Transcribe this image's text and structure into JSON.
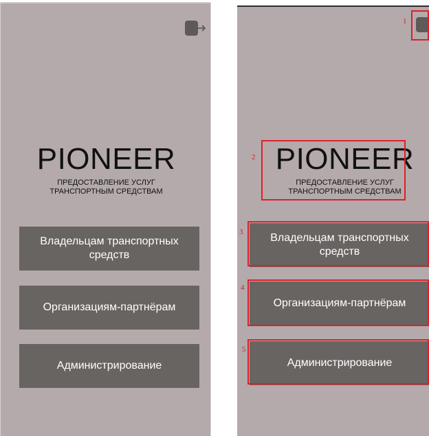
{
  "app": {
    "brand_title": "PIONEER",
    "brand_subtitle_line1": "ПРЕДОСТАВЛЕНИЕ УСЛУГ",
    "brand_subtitle_line2": "ТРАНСПОРТНЫМ СРЕДСТВАМ"
  },
  "header": {
    "exit_icon": "logout-icon"
  },
  "menu": {
    "owners_label": "Владельцам транспортных средств",
    "partners_label": "Организациям-партнёрам",
    "admin_label": "Администрирование"
  },
  "annotations": {
    "n1": "1",
    "n2": "2",
    "n3": "3",
    "n4": "4",
    "n5": "5"
  },
  "colors": {
    "screen_background": "#b4aaab",
    "button_background": "#686461",
    "button_text": "#ffffff",
    "highlight": "#e01e2a",
    "icon": "#5e5a58"
  }
}
